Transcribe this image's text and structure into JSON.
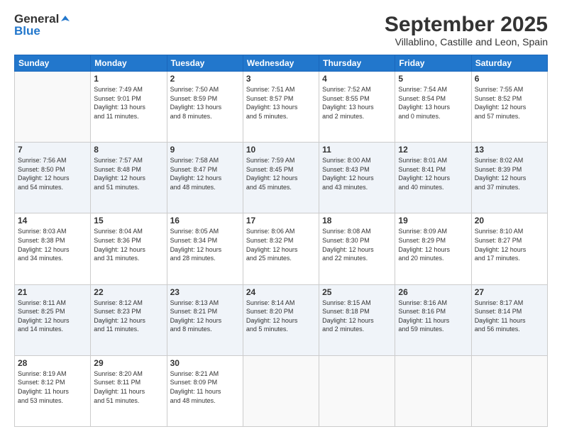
{
  "header": {
    "logo_general": "General",
    "logo_blue": "Blue",
    "title": "September 2025",
    "subtitle": "Villablino, Castille and Leon, Spain"
  },
  "weekdays": [
    "Sunday",
    "Monday",
    "Tuesday",
    "Wednesday",
    "Thursday",
    "Friday",
    "Saturday"
  ],
  "weeks": [
    [
      {
        "day": "",
        "info": ""
      },
      {
        "day": "1",
        "info": "Sunrise: 7:49 AM\nSunset: 9:01 PM\nDaylight: 13 hours\nand 11 minutes."
      },
      {
        "day": "2",
        "info": "Sunrise: 7:50 AM\nSunset: 8:59 PM\nDaylight: 13 hours\nand 8 minutes."
      },
      {
        "day": "3",
        "info": "Sunrise: 7:51 AM\nSunset: 8:57 PM\nDaylight: 13 hours\nand 5 minutes."
      },
      {
        "day": "4",
        "info": "Sunrise: 7:52 AM\nSunset: 8:55 PM\nDaylight: 13 hours\nand 2 minutes."
      },
      {
        "day": "5",
        "info": "Sunrise: 7:54 AM\nSunset: 8:54 PM\nDaylight: 13 hours\nand 0 minutes."
      },
      {
        "day": "6",
        "info": "Sunrise: 7:55 AM\nSunset: 8:52 PM\nDaylight: 12 hours\nand 57 minutes."
      }
    ],
    [
      {
        "day": "7",
        "info": "Sunrise: 7:56 AM\nSunset: 8:50 PM\nDaylight: 12 hours\nand 54 minutes."
      },
      {
        "day": "8",
        "info": "Sunrise: 7:57 AM\nSunset: 8:48 PM\nDaylight: 12 hours\nand 51 minutes."
      },
      {
        "day": "9",
        "info": "Sunrise: 7:58 AM\nSunset: 8:47 PM\nDaylight: 12 hours\nand 48 minutes."
      },
      {
        "day": "10",
        "info": "Sunrise: 7:59 AM\nSunset: 8:45 PM\nDaylight: 12 hours\nand 45 minutes."
      },
      {
        "day": "11",
        "info": "Sunrise: 8:00 AM\nSunset: 8:43 PM\nDaylight: 12 hours\nand 43 minutes."
      },
      {
        "day": "12",
        "info": "Sunrise: 8:01 AM\nSunset: 8:41 PM\nDaylight: 12 hours\nand 40 minutes."
      },
      {
        "day": "13",
        "info": "Sunrise: 8:02 AM\nSunset: 8:39 PM\nDaylight: 12 hours\nand 37 minutes."
      }
    ],
    [
      {
        "day": "14",
        "info": "Sunrise: 8:03 AM\nSunset: 8:38 PM\nDaylight: 12 hours\nand 34 minutes."
      },
      {
        "day": "15",
        "info": "Sunrise: 8:04 AM\nSunset: 8:36 PM\nDaylight: 12 hours\nand 31 minutes."
      },
      {
        "day": "16",
        "info": "Sunrise: 8:05 AM\nSunset: 8:34 PM\nDaylight: 12 hours\nand 28 minutes."
      },
      {
        "day": "17",
        "info": "Sunrise: 8:06 AM\nSunset: 8:32 PM\nDaylight: 12 hours\nand 25 minutes."
      },
      {
        "day": "18",
        "info": "Sunrise: 8:08 AM\nSunset: 8:30 PM\nDaylight: 12 hours\nand 22 minutes."
      },
      {
        "day": "19",
        "info": "Sunrise: 8:09 AM\nSunset: 8:29 PM\nDaylight: 12 hours\nand 20 minutes."
      },
      {
        "day": "20",
        "info": "Sunrise: 8:10 AM\nSunset: 8:27 PM\nDaylight: 12 hours\nand 17 minutes."
      }
    ],
    [
      {
        "day": "21",
        "info": "Sunrise: 8:11 AM\nSunset: 8:25 PM\nDaylight: 12 hours\nand 14 minutes."
      },
      {
        "day": "22",
        "info": "Sunrise: 8:12 AM\nSunset: 8:23 PM\nDaylight: 12 hours\nand 11 minutes."
      },
      {
        "day": "23",
        "info": "Sunrise: 8:13 AM\nSunset: 8:21 PM\nDaylight: 12 hours\nand 8 minutes."
      },
      {
        "day": "24",
        "info": "Sunrise: 8:14 AM\nSunset: 8:20 PM\nDaylight: 12 hours\nand 5 minutes."
      },
      {
        "day": "25",
        "info": "Sunrise: 8:15 AM\nSunset: 8:18 PM\nDaylight: 12 hours\nand 2 minutes."
      },
      {
        "day": "26",
        "info": "Sunrise: 8:16 AM\nSunset: 8:16 PM\nDaylight: 11 hours\nand 59 minutes."
      },
      {
        "day": "27",
        "info": "Sunrise: 8:17 AM\nSunset: 8:14 PM\nDaylight: 11 hours\nand 56 minutes."
      }
    ],
    [
      {
        "day": "28",
        "info": "Sunrise: 8:19 AM\nSunset: 8:12 PM\nDaylight: 11 hours\nand 53 minutes."
      },
      {
        "day": "29",
        "info": "Sunrise: 8:20 AM\nSunset: 8:11 PM\nDaylight: 11 hours\nand 51 minutes."
      },
      {
        "day": "30",
        "info": "Sunrise: 8:21 AM\nSunset: 8:09 PM\nDaylight: 11 hours\nand 48 minutes."
      },
      {
        "day": "",
        "info": ""
      },
      {
        "day": "",
        "info": ""
      },
      {
        "day": "",
        "info": ""
      },
      {
        "day": "",
        "info": ""
      }
    ]
  ]
}
